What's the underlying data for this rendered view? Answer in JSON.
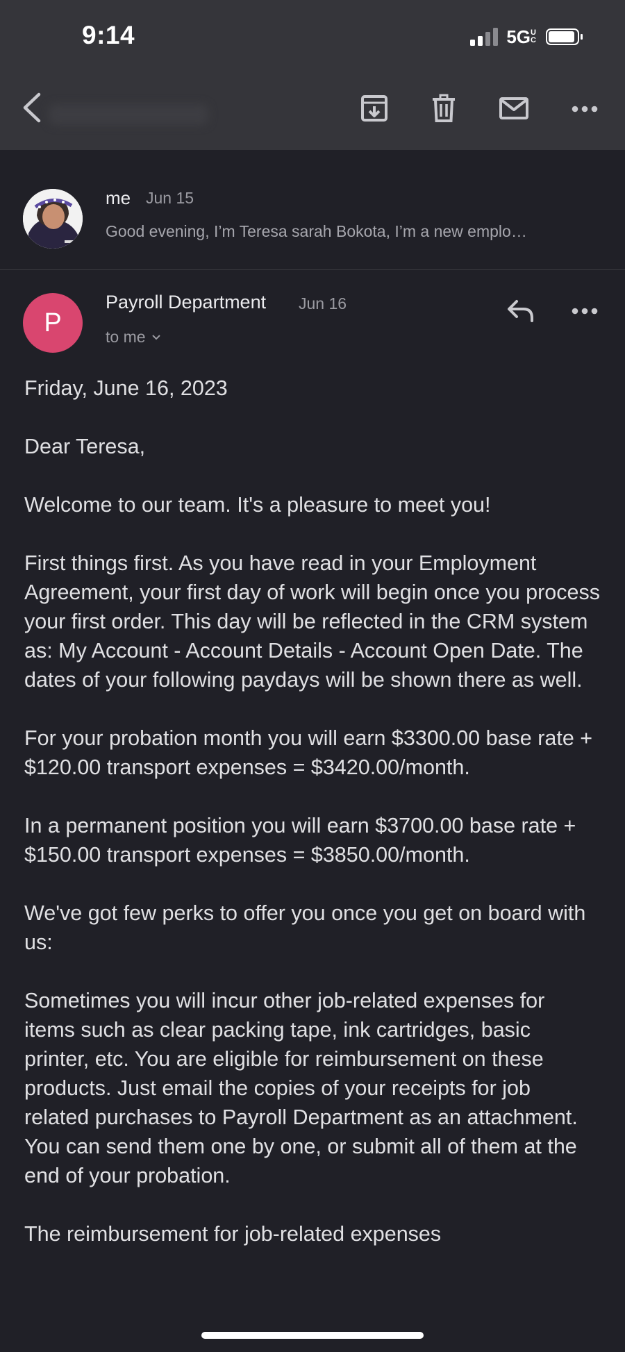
{
  "status_bar": {
    "time": "9:14",
    "network": "5G",
    "network_suffix": "UC"
  },
  "toolbar": {
    "back_icon": "chevron-left-icon",
    "archive_icon": "archive-icon",
    "delete_icon": "trash-icon",
    "mark_unread_icon": "mail-icon",
    "more_icon": "more-horizontal-icon"
  },
  "thread": {
    "collapsed_message": {
      "from": "me",
      "date": "Jun 15",
      "snippet": "Good evening, I’m Teresa sarah Bokota, I’m a new emplo…"
    },
    "open_message": {
      "avatar_letter": "P",
      "avatar_color": "#d9466f",
      "from": "Payroll Department",
      "date": "Jun 16",
      "recipient": "to me",
      "body": [
        "Friday, June 16, 2023",
        "Dear Teresa,",
        "Welcome to our team. It's a pleasure to meet you!",
        "First things first. As you have read in your Employment Agreement, your first day of work will begin once you process your first order. This day will be reflected in the CRM system as: My Account - Account Details - Account Open Date. The dates of your following paydays will be shown there as well.",
        "For your probation month you will earn $3300.00 base rate + $120.00 transport expenses = $3420.00/month.",
        "In a permanent position you will earn $3700.00 base rate + $150.00 transport expenses = $3850.00/month.",
        "We've got few perks to offer you once you get on board with us:",
        "Sometimes you will incur other job-related expenses for items such as clear packing tape, ink cartridges, basic printer, etc. You are eligible for reimbursement on these products. Just email the copies of your receipts for job related purchases to Payroll Department as an attachment. You can send them one by one, or submit all of them at the end of your probation.",
        "The reimbursement for job-related expenses"
      ]
    }
  }
}
